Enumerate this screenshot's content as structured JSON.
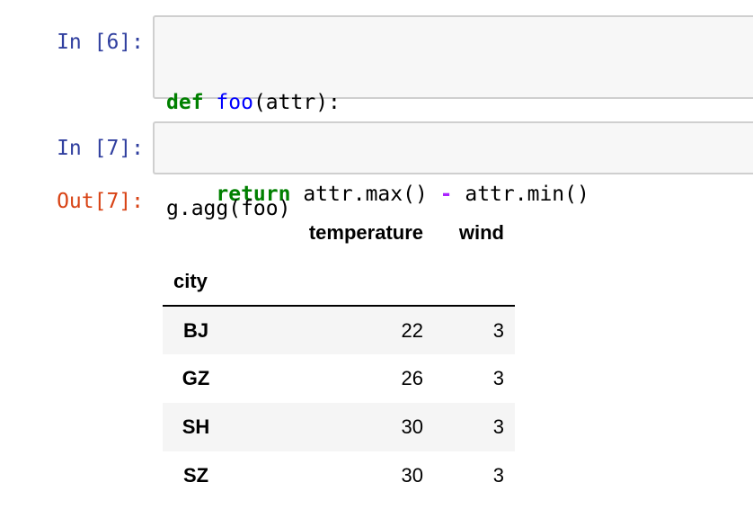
{
  "cells": [
    {
      "prompt": "In [6]:",
      "lines": [
        [
          {
            "text": "def",
            "style": "kw"
          },
          {
            "text": " ",
            "style": "plain"
          },
          {
            "text": "foo",
            "style": "fn"
          },
          {
            "text": "(attr):",
            "style": "plain"
          }
        ],
        [
          {
            "text": "    ",
            "style": "plain"
          },
          {
            "text": "return",
            "style": "kw"
          },
          {
            "text": " attr.max() ",
            "style": "plain"
          },
          {
            "text": "-",
            "style": "op"
          },
          {
            "text": " attr.min()",
            "style": "plain"
          }
        ]
      ]
    },
    {
      "prompt": "In [7]:",
      "lines": [
        [
          {
            "text": "g.agg(foo)",
            "style": "plain"
          }
        ]
      ]
    }
  ],
  "output": {
    "prompt": "Out[7]:",
    "table": {
      "columns": [
        "temperature",
        "wind"
      ],
      "index_name": "city",
      "rows": [
        {
          "city": "BJ",
          "temperature": "22",
          "wind": "3"
        },
        {
          "city": "GZ",
          "temperature": "26",
          "wind": "3"
        },
        {
          "city": "SH",
          "temperature": "30",
          "wind": "3"
        },
        {
          "city": "SZ",
          "temperature": "30",
          "wind": "3"
        }
      ]
    }
  }
}
